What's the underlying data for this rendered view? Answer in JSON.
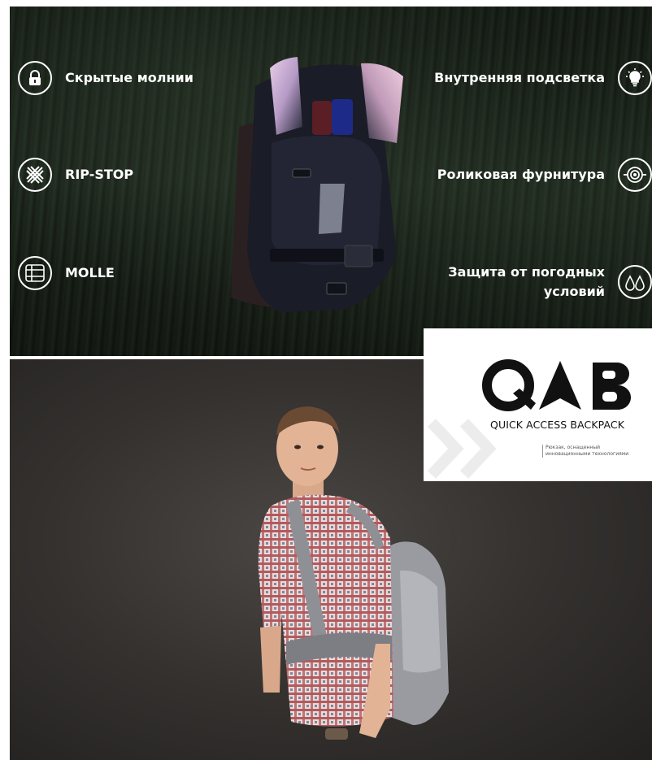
{
  "features": {
    "hidden_zippers": "Скрытые молнии",
    "rip_stop": "RIP-STOP",
    "molle": "MOLLE",
    "inner_light": "Внутренняя подсветка",
    "roller_hardware": "Роликовая фурнитура",
    "weather_line1": "Защита от погодных",
    "weather_line2": "условий"
  },
  "logo": {
    "mark_text": "QAB",
    "subtitle": "QUICK ACCESS BACKPACK",
    "tagline_line1": "Рюкзак, оснащенный",
    "tagline_line2": "инновационными технологиями"
  },
  "colors": {
    "forest": "#1b231a",
    "studio": "#34312f",
    "white": "#ffffff",
    "black": "#111111"
  }
}
